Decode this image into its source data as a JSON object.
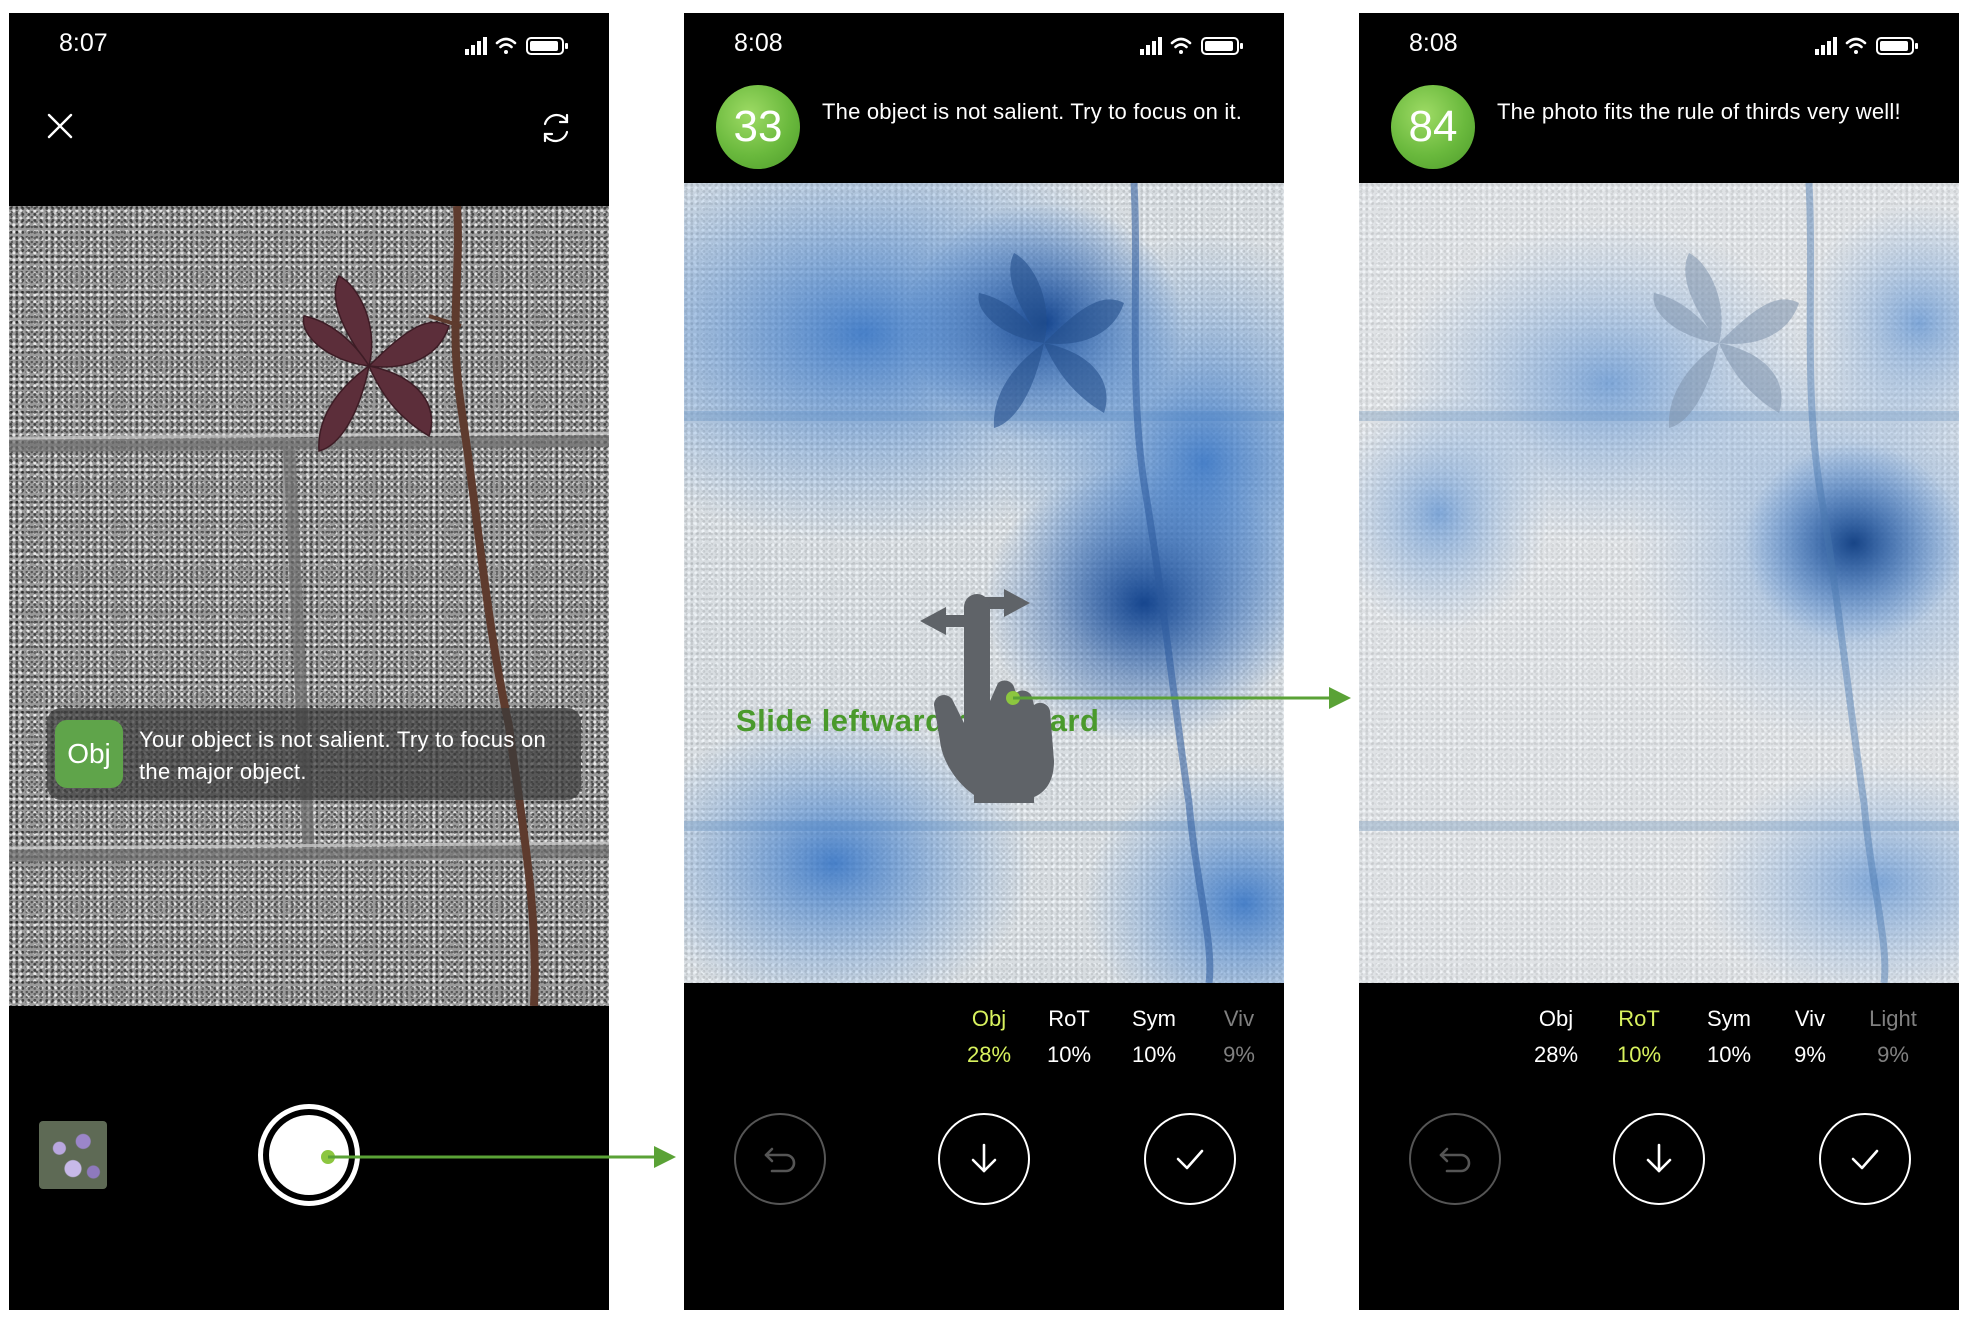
{
  "screens": [
    {
      "status_time": "8:07",
      "toast": {
        "badge": "Obj",
        "message": "Your object is not salient. Try to focus on the major object."
      }
    },
    {
      "status_time": "8:08",
      "score": "33",
      "hint": "The object is not salient. Try to focus on it.",
      "gesture_label": "Slide leftward/rightward",
      "metrics": [
        {
          "name": "Obj",
          "value": "28%",
          "state": "active"
        },
        {
          "name": "RoT",
          "value": "10%",
          "state": "normal"
        },
        {
          "name": "Sym",
          "value": "10%",
          "state": "normal"
        },
        {
          "name": "Viv",
          "value": "9%",
          "state": "faded"
        }
      ]
    },
    {
      "status_time": "8:08",
      "score": "84",
      "hint": "The photo fits the rule of thirds very well!",
      "metrics": [
        {
          "name": "Obj",
          "value": "28%",
          "state": "normal"
        },
        {
          "name": "RoT",
          "value": "10%",
          "state": "active"
        },
        {
          "name": "Sym",
          "value": "10%",
          "state": "normal"
        },
        {
          "name": "Viv",
          "value": "9%",
          "state": "normal"
        },
        {
          "name": "Light",
          "value": "9%",
          "state": "faded"
        }
      ]
    }
  ],
  "colors": {
    "score_green": "#6ab93d",
    "active_metric": "#d8f25e",
    "connector_green": "#5aa236",
    "heat_blue": "#1f5fb0"
  },
  "icons": [
    "close-icon",
    "camera-flip-icon",
    "signal-icon",
    "wifi-icon",
    "battery-icon",
    "undo-icon",
    "download-icon",
    "check-icon",
    "swipe-hand-icon"
  ]
}
